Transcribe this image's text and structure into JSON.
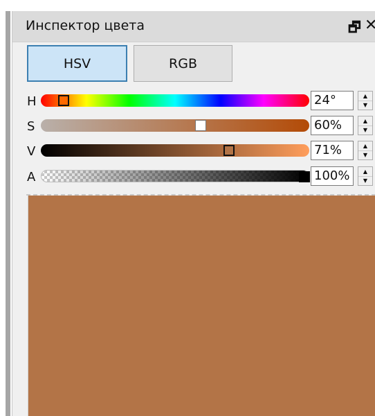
{
  "panel": {
    "title": "Инспектор цвета",
    "float_icon": "float-window-icon",
    "close_icon": "close-icon"
  },
  "tabs": [
    {
      "label": "HSV",
      "selected": true
    },
    {
      "label": "RGB",
      "selected": false
    }
  ],
  "channels": {
    "h": {
      "label": "H",
      "value": "24°",
      "position": 0.067
    },
    "s": {
      "label": "S",
      "value": "60%",
      "position": 0.6
    },
    "v": {
      "label": "V",
      "value": "71%",
      "position": 0.71
    },
    "a": {
      "label": "A",
      "value": "100%",
      "position": 1.0
    }
  },
  "color": {
    "preview": "#b37447",
    "s_track_start": "#b9b0aa",
    "s_track_end": "#b34b07",
    "v_track_start": "#000000",
    "v_track_end": "#ff9e5c"
  }
}
